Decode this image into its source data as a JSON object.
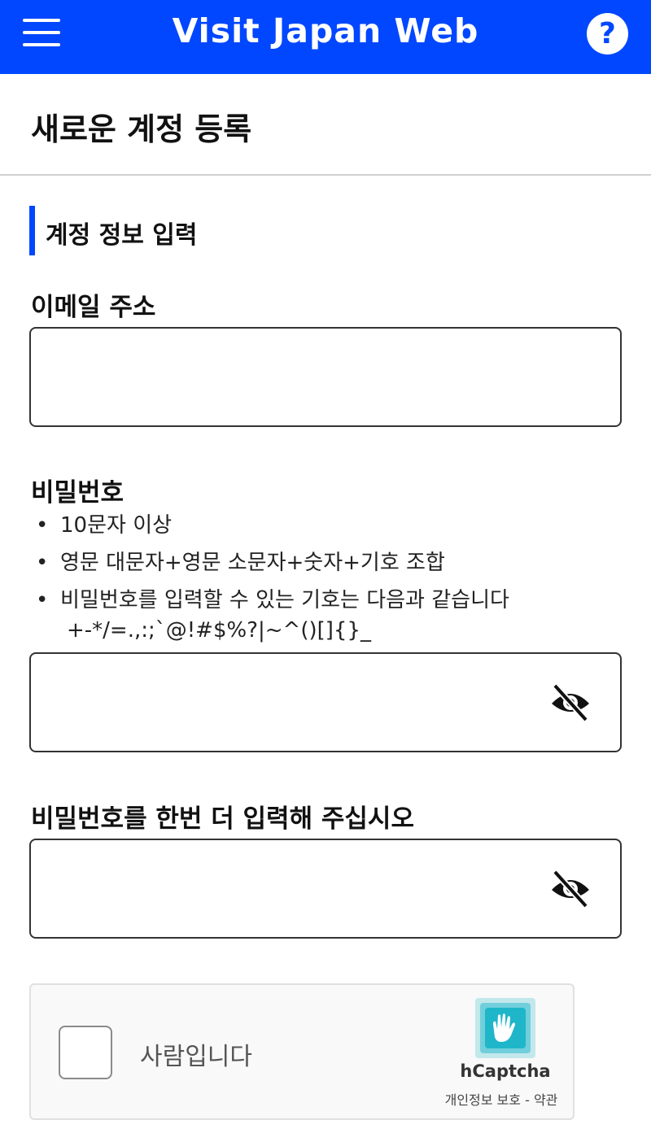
{
  "header": {
    "title": "Visit Japan Web",
    "help_label": "?"
  },
  "page": {
    "title": "새로운 계정 등록"
  },
  "section": {
    "title": "계정 정보 입력"
  },
  "email": {
    "label": "이메일 주소",
    "value": "",
    "placeholder": ""
  },
  "password": {
    "label": "비밀번호",
    "value": "",
    "placeholder": "",
    "rules": [
      "10문자 이상",
      "영문 대문자+영문 소문자+숫자+기호 조합",
      "비밀번호를 입력할 수 있는 기호는 다음과 같습니다"
    ],
    "symbols": "+-*/=.,:;`@!#$%?|~^()[]{}_"
  },
  "password_confirm": {
    "label": "비밀번호를 한번 더 입력해 주십시오",
    "value": "",
    "placeholder": ""
  },
  "captcha": {
    "checkbox_label": "사람입니다",
    "brand": "hCaptcha",
    "privacy_link": "개인정보 보호",
    "separator": " - ",
    "terms_link": "약관"
  },
  "icons": {
    "menu": "menu-icon",
    "help": "help-icon",
    "visibility": "eye-off-icon",
    "captcha_logo": "hcaptcha-logo-icon"
  },
  "colors": {
    "brand": "#0047ff",
    "captcha_logo": "#1fb6c9"
  }
}
